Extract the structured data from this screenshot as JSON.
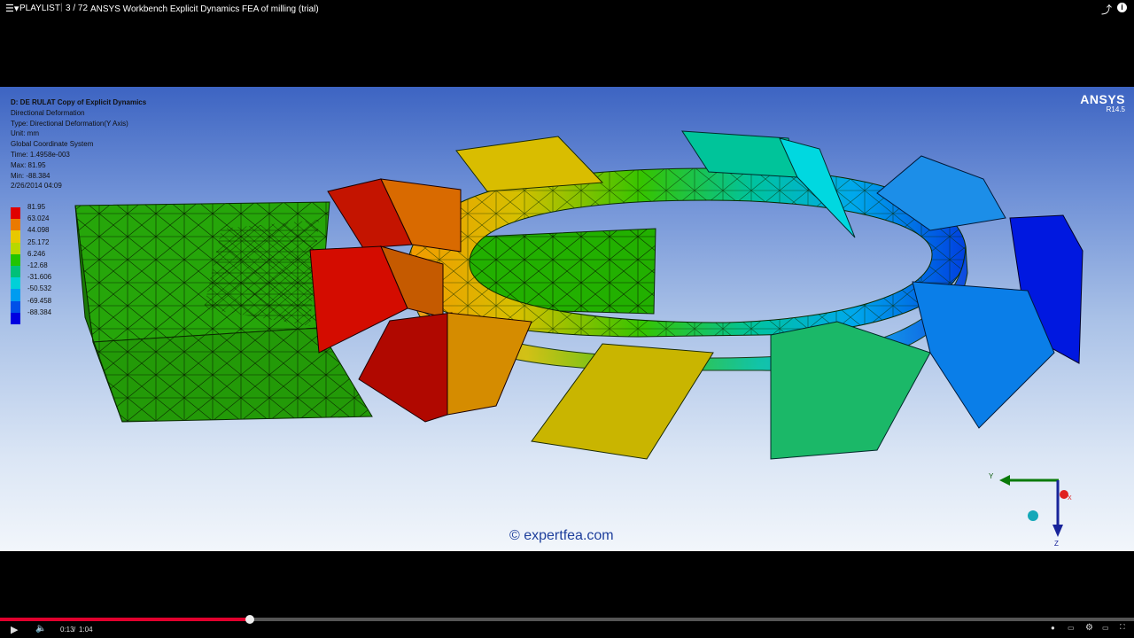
{
  "player": {
    "playlist_label": "PLAYLIST",
    "playlist_index": "3 / 72",
    "video_title": "ANSYS Workbench Explicit Dynamics FEA of milling (trial)",
    "time_current": "0:13",
    "time_total": "1:04",
    "progress": 0.22,
    "progress_color": "#e1002d"
  },
  "viewer": {
    "title": "D: DE RULAT Copy of Explicit Dynamics",
    "result": "Directional Deformation",
    "type": "Type: Directional Deformation(Y Axis)",
    "unit": "Unit: mm",
    "coord": "Global Coordinate System",
    "time": "Time: 1.4958e-003",
    "max": "Max: 81.95",
    "min": "Min: -88.384",
    "date": "2/26/2014 04:09",
    "brand": "ANSYS",
    "version": "R14.5",
    "watermark": "© expertfea.com",
    "legend": [
      {
        "value": "81.95",
        "color": "#e00000"
      },
      {
        "value": "63.024",
        "color": "#ea7a00"
      },
      {
        "value": "44.098",
        "color": "#e8c800"
      },
      {
        "value": "25.172",
        "color": "#b8d800"
      },
      {
        "value": "6.246",
        "color": "#22c400"
      },
      {
        "value": "-12.68",
        "color": "#00c07a"
      },
      {
        "value": "-31.606",
        "color": "#00d0d8"
      },
      {
        "value": "-50.532",
        "color": "#009cf0"
      },
      {
        "value": "-69.458",
        "color": "#0050e8"
      },
      {
        "value": "-88.384",
        "color": "#0000e0"
      }
    ],
    "axis_y": "Y",
    "axis_z": "Z",
    "axis_x": "X"
  }
}
